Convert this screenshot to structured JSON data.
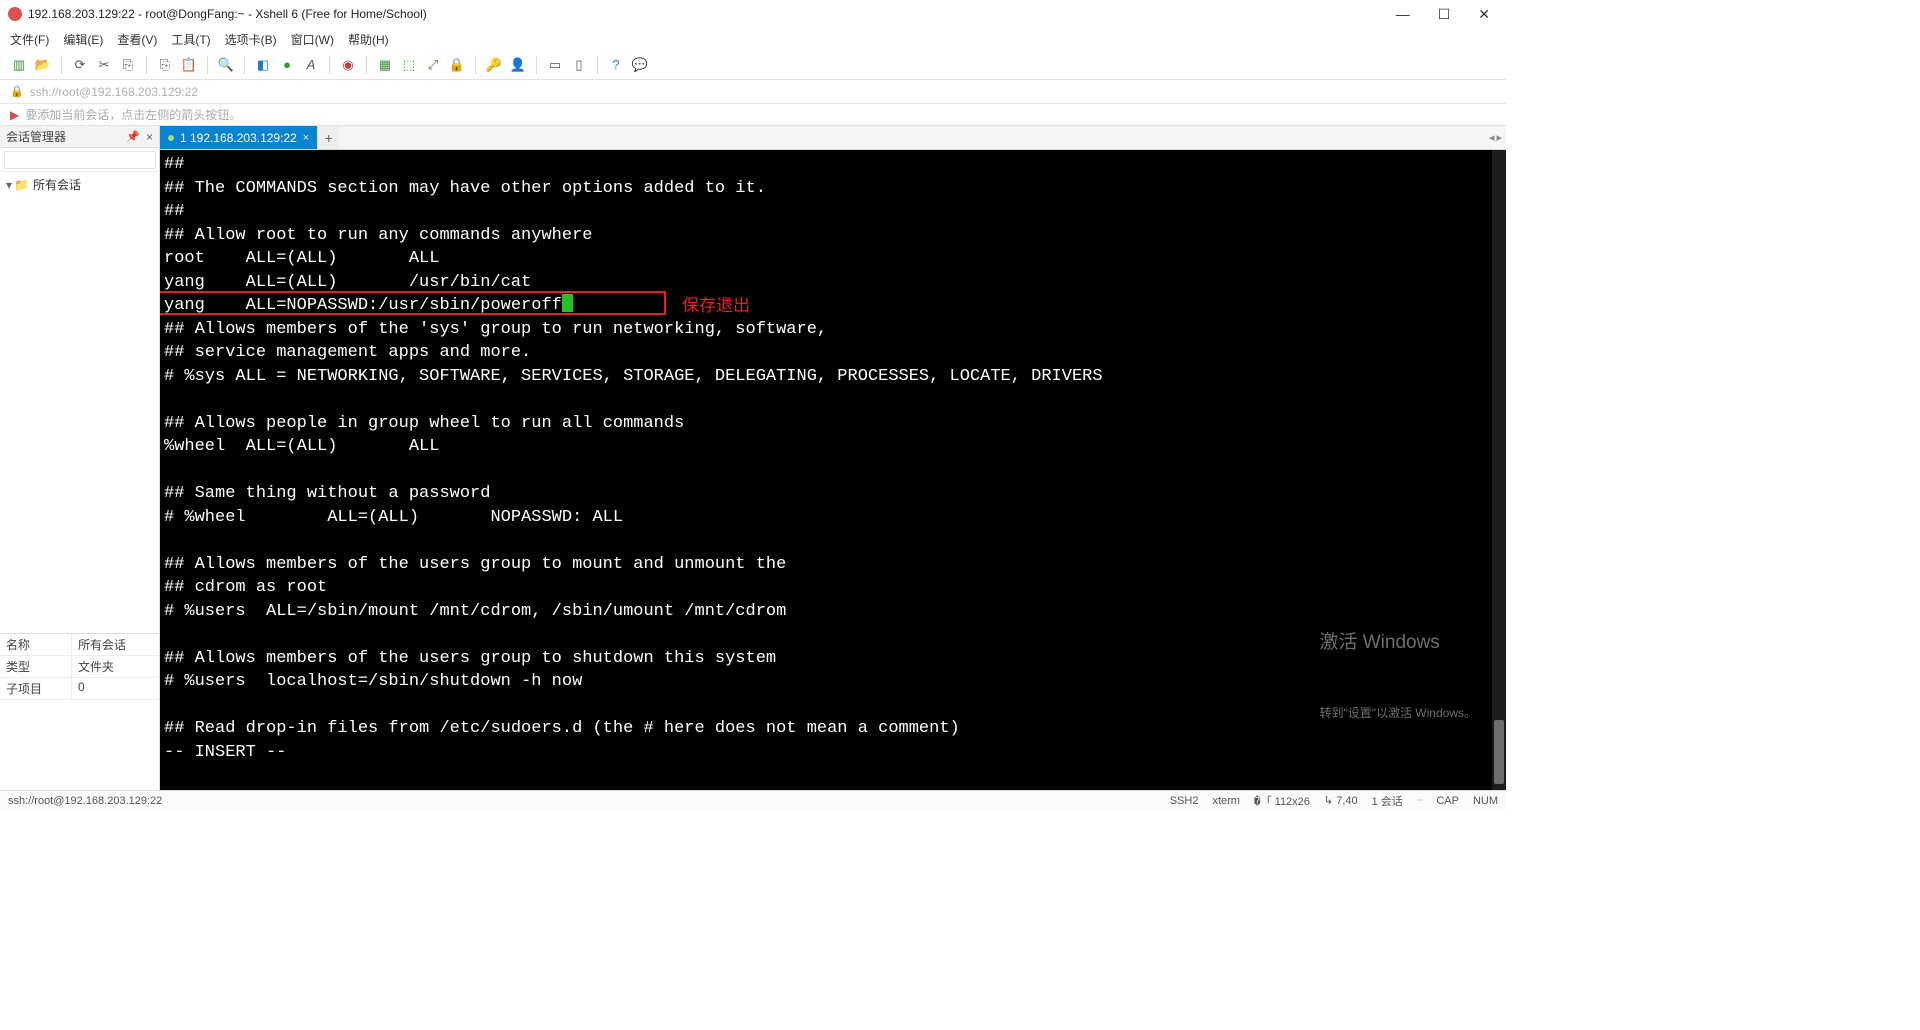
{
  "window": {
    "title": "192.168.203.129:22 - root@DongFang:~ - Xshell 6 (Free for Home/School)"
  },
  "menu": {
    "file": "文件(F)",
    "edit": "编辑(E)",
    "view": "查看(V)",
    "tools": "工具(T)",
    "tabs": "选项卡(B)",
    "window": "窗口(W)",
    "help": "帮助(H)"
  },
  "addressbar": {
    "url": "ssh://root@192.168.203.129:22"
  },
  "infobar": {
    "text": "要添加当前会话，点击左侧的箭头按钮。"
  },
  "sidebar": {
    "title": "会话管理器",
    "search_placeholder": "",
    "root_folder": "所有会话",
    "props": [
      {
        "k": "名称",
        "v": "所有会话"
      },
      {
        "k": "类型",
        "v": "文件夹"
      },
      {
        "k": "子项目",
        "v": "0"
      }
    ]
  },
  "tabs": {
    "active": "1 192.168.203.129:22"
  },
  "terminal": {
    "lines_before": "##\n## The COMMANDS section may have other options added to it.\n##\n## Allow root to run any commands anywhere\nroot    ALL=(ALL)       ALL\nyang    ALL=(ALL)       /usr/bin/cat",
    "highlight_line": "yang    ALL=NOPASSWD:/usr/sbin/poweroff",
    "annotation": "保存退出",
    "lines_after": "## Allows members of the 'sys' group to run networking, software,\n## service management apps and more.\n# %sys ALL = NETWORKING, SOFTWARE, SERVICES, STORAGE, DELEGATING, PROCESSES, LOCATE, DRIVERS\n\n## Allows people in group wheel to run all commands\n%wheel  ALL=(ALL)       ALL\n\n## Same thing without a password\n# %wheel        ALL=(ALL)       NOPASSWD: ALL\n\n## Allows members of the users group to mount and unmount the\n## cdrom as root\n# %users  ALL=/sbin/mount /mnt/cdrom, /sbin/umount /mnt/cdrom\n\n## Allows members of the users group to shutdown this system\n# %users  localhost=/sbin/shutdown -h now\n\n## Read drop-in files from /etc/sudoers.d (the # here does not mean a comment)\n-- INSERT --"
  },
  "watermark": {
    "l1": "激活 Windows",
    "l2": "转到\"设置\"以激活 Windows。"
  },
  "status": {
    "left": "ssh://root@192.168.203.129:22",
    "ssh": "SSH2",
    "term": "xterm",
    "size": "112x26",
    "pos": "7,40",
    "sess": "1 会话",
    "cap": "CAP",
    "num": "NUM"
  }
}
